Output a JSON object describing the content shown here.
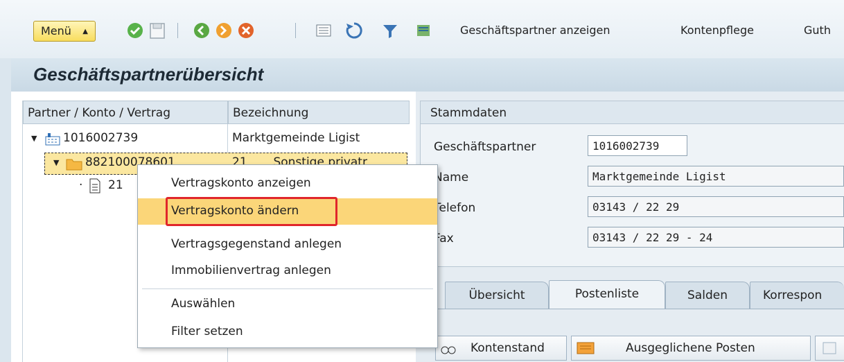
{
  "toolbar": {
    "menu_label": "Menü",
    "icons": [
      "check-icon",
      "save-icon",
      "back-icon",
      "exit-icon",
      "cancel-icon",
      "list-icon",
      "refresh-icon",
      "filter-icon",
      "settings-icon"
    ],
    "links": [
      "Geschäftspartner anzeigen",
      "Kontenpflege",
      "Guth"
    ]
  },
  "title": "Geschäftspartnerübersicht",
  "tree": {
    "col_partner": "Partner / Konto / Vertrag",
    "col_desc": "Bezeichnung",
    "rows": [
      {
        "label": "1016002739",
        "desc": "Marktgemeinde Ligist"
      },
      {
        "label": "882100078601",
        "desc": "21       Sonstige privatr"
      },
      {
        "label": "21",
        "desc": ""
      }
    ]
  },
  "context_menu": {
    "items": [
      "Vertragskonto anzeigen",
      "Vertragskonto ändern",
      "Vertragsgegenstand anlegen",
      "Immobilienvertrag anlegen",
      "Auswählen",
      "Filter setzen"
    ],
    "highlighted": "Vertragskonto ändern"
  },
  "stammdaten": {
    "heading": "Stammdaten",
    "partner_label": "Geschäftspartner",
    "partner_value": "1016002739",
    "name_label": "Name",
    "name_value": "Marktgemeinde Ligist",
    "phone_label": "Telefon",
    "phone_value": "03143 / 22 29",
    "fax_label": "Fax",
    "fax_value": "03143 / 22 29 - 24"
  },
  "tabs": [
    "Übersicht",
    "Postenliste",
    "Salden",
    "Korrespon"
  ],
  "active_tab": "Postenliste",
  "buttons": {
    "kontenstand": "Kontenstand",
    "ausgeglichen": "Ausgeglichene Posten"
  },
  "colors": {
    "menu_hover": "#fbd679",
    "highlight_border": "#e0262b",
    "menu_button": "#f8dd5e"
  }
}
